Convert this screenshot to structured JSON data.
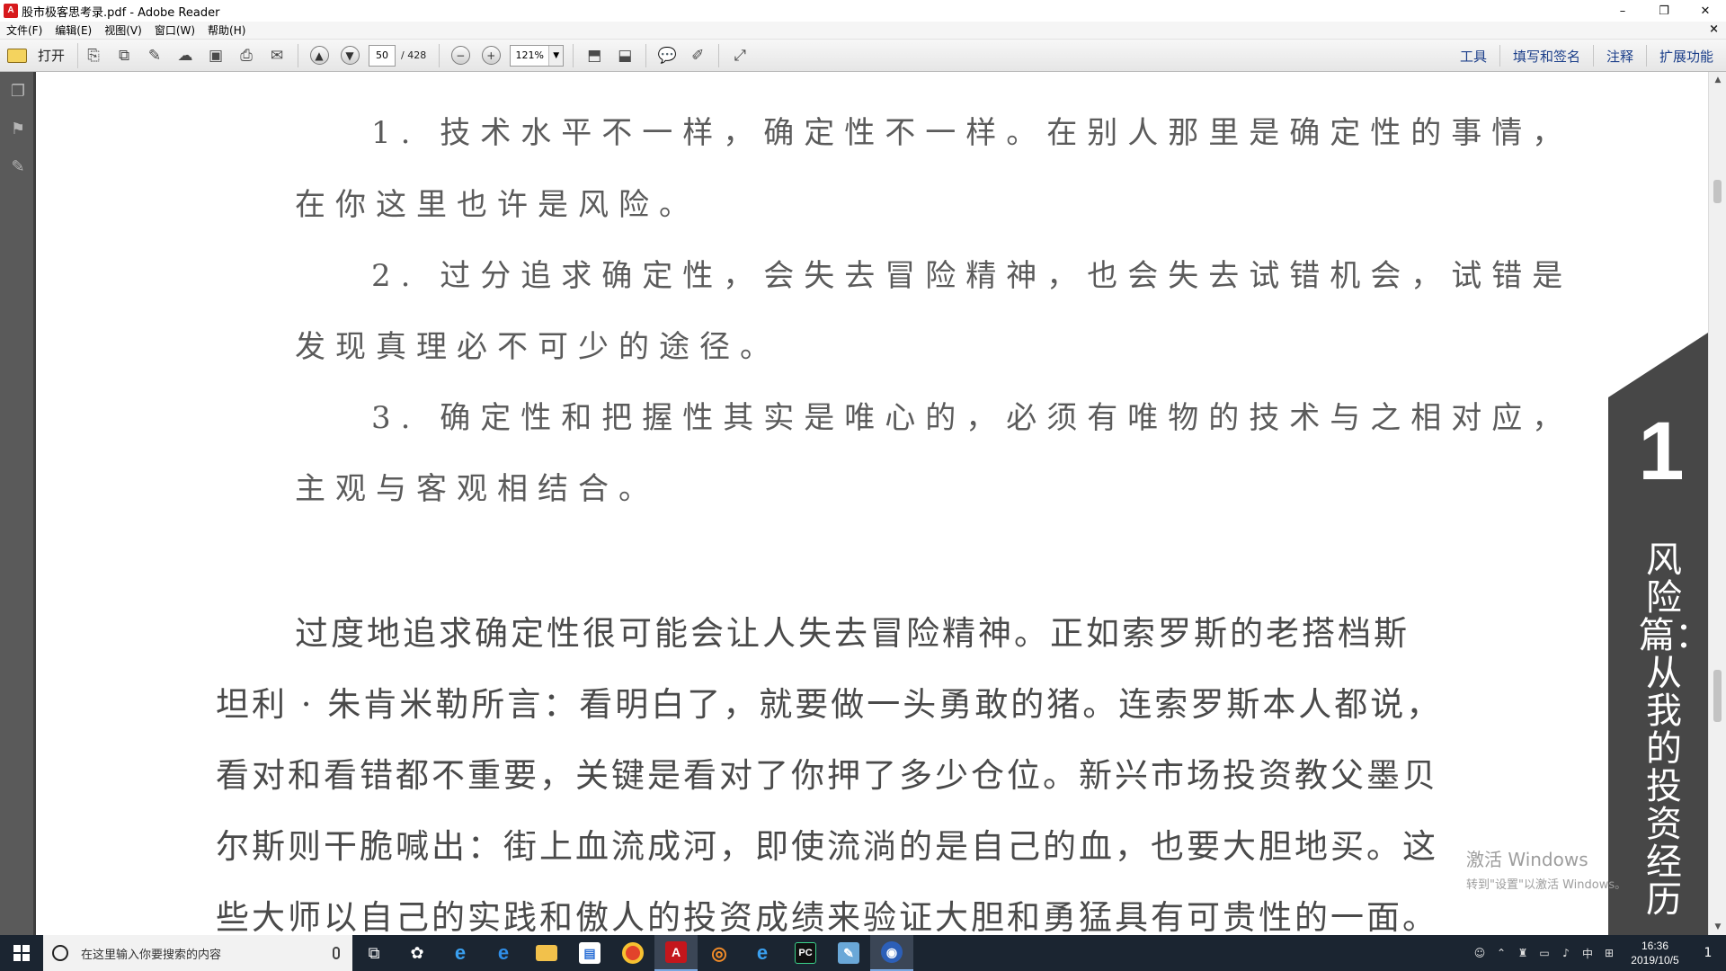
{
  "window": {
    "app_icon": "pdf-icon",
    "title": "股市极客思考录.pdf - Adobe Reader",
    "minimize": "–",
    "maximize": "❐",
    "close": "✕"
  },
  "menubar": {
    "items": [
      "文件(F)",
      "编辑(E)",
      "视图(V)",
      "窗口(W)",
      "帮助(H)"
    ],
    "doc_close": "×"
  },
  "toolbar": {
    "open_label": "打开",
    "page_current": "50",
    "page_total": "/ 428",
    "zoom": "121%",
    "right_panels": [
      "工具",
      "填写和签名",
      "注释",
      "扩展功能"
    ]
  },
  "document": {
    "list_lines": [
      "1.  技术水平不一样，确定性不一样。在别人那里是确定性的事情，",
      "在你这里也许是风险。",
      "2.  过分追求确定性，会失去冒险精神，也会失去试错机会，试错是",
      "发现真理必不可少的途径。",
      "3.  确定性和把握性其实是唯心的，必须有唯物的技术与之相对应，",
      "主观与客观相结合。"
    ],
    "body_lines": [
      "过度地追求确定性很可能会让人失去冒险精神。正如索罗斯的老搭档斯",
      "坦利 · 朱肯米勒所言：看明白了，就要做一头勇敢的猪。连索罗斯本人都说，",
      "看对和看错都不重要，关键是看对了你押了多少仓位。新兴市场投资教父墨贝",
      "尔斯则干脆喊出：街上血流成河，即使流淌的是自己的血，也要大胆地买。这",
      "些大师以自己的实践和傲人的投资成绩来验证大胆和勇猛具有可贵性的一面。"
    ],
    "chapter_number": "1",
    "chapter_title": "风险篇：从我的投资经历"
  },
  "watermark": {
    "line1": "激活 Windows",
    "line2": "转到\"设置\"以激活 Windows。"
  },
  "taskbar": {
    "search_placeholder": "在这里输入你要搜索的内容",
    "apps": [
      {
        "icon": "task-view-icon",
        "glyph": "⧉"
      },
      {
        "icon": "pinwheel-icon",
        "glyph": "✿"
      },
      {
        "icon": "ie-icon",
        "glyph": "e"
      },
      {
        "icon": "edge-icon",
        "glyph": "e"
      },
      {
        "icon": "file-explorer-icon",
        "glyph": "▰"
      },
      {
        "icon": "store-icon",
        "glyph": "▤"
      },
      {
        "icon": "chrome-icon",
        "glyph": "●"
      },
      {
        "icon": "acrobat-icon",
        "glyph": "A"
      },
      {
        "icon": "jupyter-icon",
        "glyph": "◎"
      },
      {
        "icon": "ie-blue-icon",
        "glyph": "e"
      },
      {
        "icon": "pycharm-icon",
        "glyph": "PC"
      },
      {
        "icon": "notepad-icon",
        "glyph": "✎"
      },
      {
        "icon": "browser-icon",
        "glyph": "◉"
      }
    ],
    "tray": {
      "ime": "中",
      "time": "16:36",
      "date": "2019/10/5",
      "notification_count": "1"
    }
  },
  "colors": {
    "nav_pane": "#5a5a5a",
    "chapter_tab": "#474747",
    "taskbar": "#1b2531",
    "panel_link": "#1c3f8a"
  }
}
